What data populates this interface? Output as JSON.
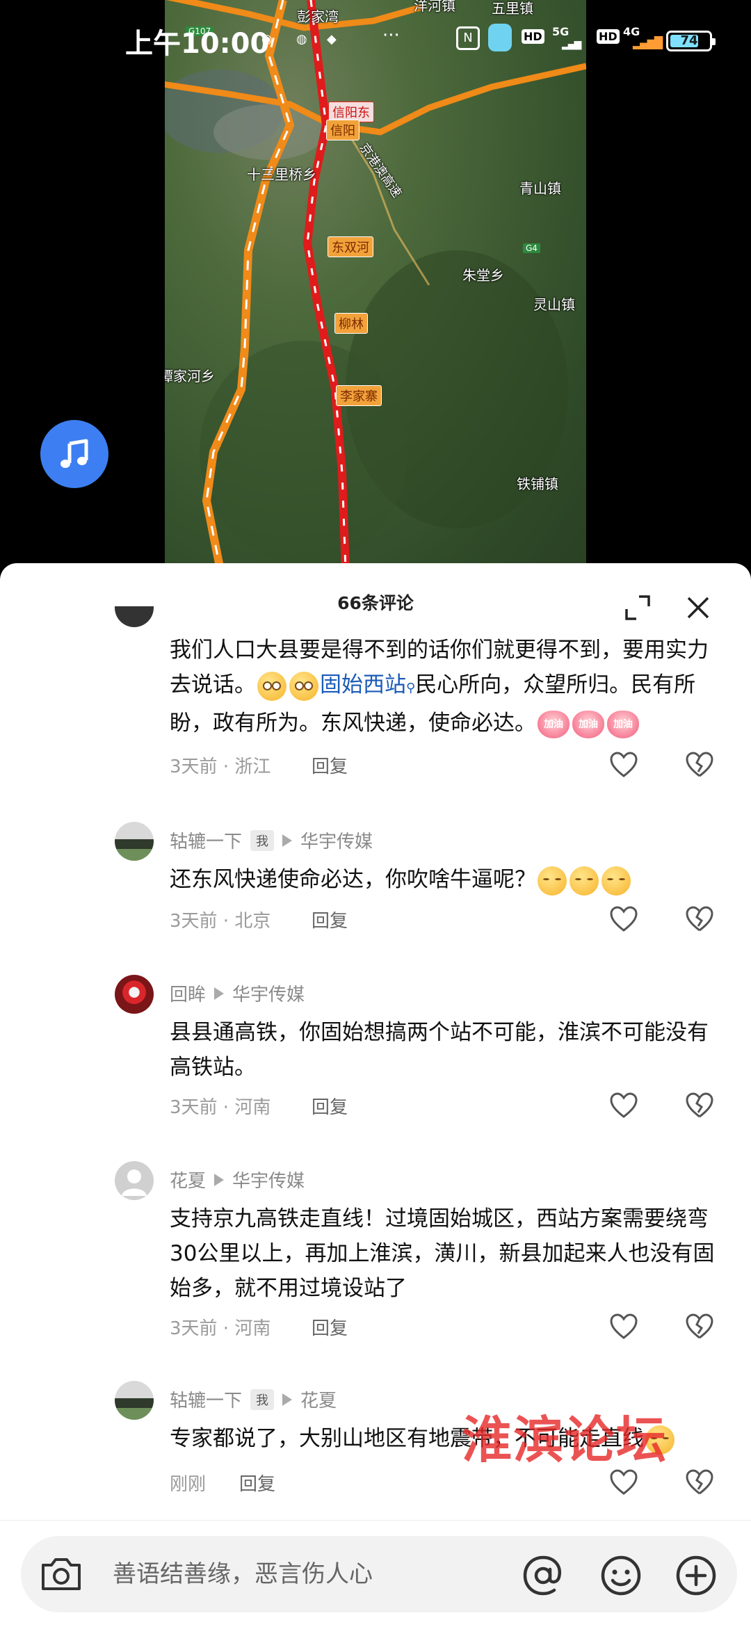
{
  "status_bar": {
    "time": "上午10:00",
    "network_5g": "5G",
    "network_4g": "4G",
    "hd_1": "HD",
    "hd_2": "HD",
    "battery": "74",
    "battery_level_percent": 74
  },
  "video": {
    "map_labels": {
      "pengjiawan": "彭家湾",
      "yanghe": "洋河镇",
      "wulizhen": "五里镇",
      "g107": "G107",
      "xinyang_east": "信阳东",
      "xinyang": "信阳",
      "shisanliqiao": "十三里桥乡",
      "jinggang_ao": "京港澳高速",
      "qingshan": "青山镇",
      "dongshuanghe": "东双河",
      "g4": "G4",
      "zhutang": "朱堂乡",
      "lingshan": "灵山镇",
      "liulin": "柳林",
      "tanjiahe": "谭家河乡",
      "lijiazhai": "李家寨",
      "tiepu": "铁铺镇"
    },
    "music_icon": "music-note-icon"
  },
  "comments_panel": {
    "title": "66条评论",
    "expand_icon": "expand-icon",
    "close_icon": "close-icon",
    "comments": [
      {
        "text_1": "我们人口大县要是得不到的话你们就更得不到，要用实力去说话。",
        "link": "固始西站",
        "text_2": "民心所向，众望所归。民有所盼，政有所为。东风快递，使命必达。",
        "emoji_label": "加油",
        "time_loc": "3天前 · 浙江",
        "reply": "回复"
      },
      {
        "user": "轱辘一下",
        "me": "我",
        "reply_to": "华宇传媒",
        "text": "还东风快递使命必达，你吹啥牛逼呢？",
        "time_loc": "3天前 · 北京",
        "reply": "回复"
      },
      {
        "user": "回眸",
        "reply_to": "华宇传媒",
        "text": "县县通高铁，你固始想搞两个站不可能，淮滨不可能没有高铁站。",
        "time_loc": "3天前 · 河南",
        "reply": "回复"
      },
      {
        "user": "花夏",
        "reply_to": "华宇传媒",
        "text": "支持京九高铁走直线！过境固始城区，西站方案需要绕弯30公里以上，再加上淮滨，潢川，新县加起来人也没有固始多，就不用过境设站了",
        "time_loc": "3天前 · 河南",
        "reply": "回复"
      },
      {
        "user": "轱辘一下",
        "me": "我",
        "reply_to": "花夏",
        "text": "专家都说了，大别山地区有地震带，不可能走直线",
        "time_loc": "刚刚",
        "reply": "回复"
      }
    ]
  },
  "watermark": "淮滨论坛",
  "input_bar": {
    "placeholder": "善语结善缘，恶言伤人心",
    "camera_icon": "camera-icon",
    "at_icon": "at-icon",
    "emoji_icon": "emoji-icon",
    "plus_icon": "plus-icon"
  }
}
